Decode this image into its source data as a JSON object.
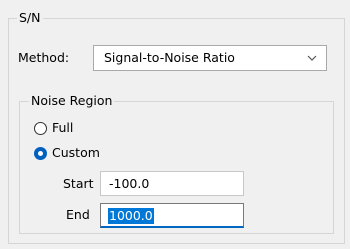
{
  "sn_group": {
    "title": "S/N"
  },
  "method": {
    "label": "Method:",
    "selected": "Signal-to-Noise Ratio"
  },
  "noise_region": {
    "title": "Noise Region",
    "options": [
      {
        "label": "Full",
        "selected": false
      },
      {
        "label": "Custom",
        "selected": true
      }
    ],
    "start": {
      "label": "Start",
      "value": "-100.0"
    },
    "end": {
      "label": "End",
      "value": "1000.0"
    }
  },
  "icons": {
    "dropdown": "chevron-down-icon"
  },
  "colors": {
    "accent": "#0060c0",
    "selection": "#0078d7"
  }
}
